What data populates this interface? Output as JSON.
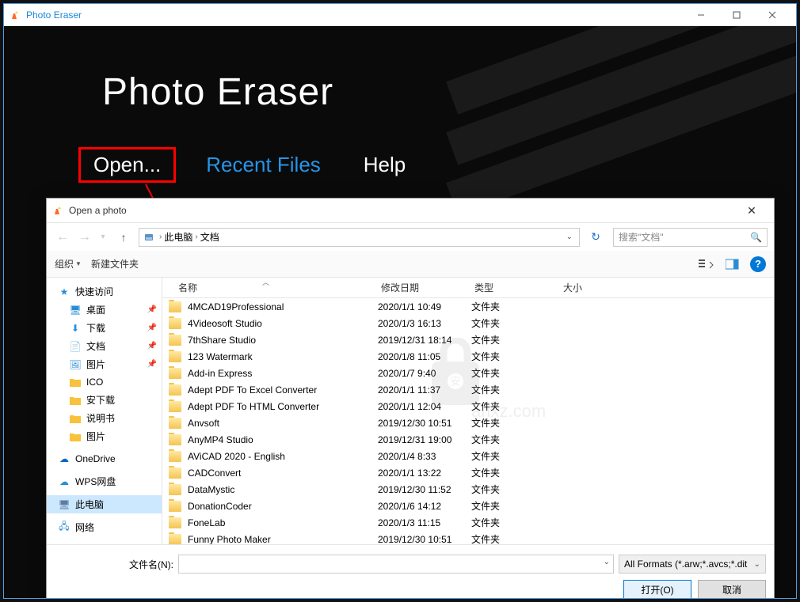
{
  "app": {
    "title": "Photo Eraser",
    "main_title": "Photo Eraser",
    "menu": {
      "open": "Open...",
      "recent": "Recent Files",
      "help": "Help"
    }
  },
  "dialog": {
    "title": "Open a photo",
    "breadcrumb": {
      "root": "此电脑",
      "current": "文档"
    },
    "search_placeholder": "搜索\"文档\"",
    "toolbar": {
      "organize": "组织",
      "new_folder": "新建文件夹"
    },
    "columns": {
      "name": "名称",
      "date": "修改日期",
      "type": "类型",
      "size": "大小"
    },
    "sidebar": {
      "quick_access": "快速访问",
      "items": [
        {
          "label": "桌面",
          "icon": "desktop",
          "pinned": true
        },
        {
          "label": "下载",
          "icon": "download",
          "pinned": true
        },
        {
          "label": "文档",
          "icon": "docs",
          "pinned": true
        },
        {
          "label": "图片",
          "icon": "pics",
          "pinned": true
        },
        {
          "label": "ICO",
          "icon": "folder",
          "pinned": false
        },
        {
          "label": "安下载",
          "icon": "folder",
          "pinned": false
        },
        {
          "label": "说明书",
          "icon": "folder",
          "pinned": false
        },
        {
          "label": "图片",
          "icon": "folder",
          "pinned": false
        }
      ],
      "onedrive": "OneDrive",
      "wps": "WPS网盘",
      "this_pc": "此电脑",
      "network": "网络"
    },
    "files": [
      {
        "name": "4MCAD19Professional",
        "date": "2020/1/1 10:49",
        "type": "文件夹"
      },
      {
        "name": "4Videosoft Studio",
        "date": "2020/1/3 16:13",
        "type": "文件夹"
      },
      {
        "name": "7thShare Studio",
        "date": "2019/12/31 18:14",
        "type": "文件夹"
      },
      {
        "name": "123 Watermark",
        "date": "2020/1/8 11:05",
        "type": "文件夹"
      },
      {
        "name": "Add-in Express",
        "date": "2020/1/7 9:40",
        "type": "文件夹"
      },
      {
        "name": "Adept PDF To Excel Converter",
        "date": "2020/1/1 11:37",
        "type": "文件夹"
      },
      {
        "name": "Adept PDF To HTML Converter",
        "date": "2020/1/1 12:04",
        "type": "文件夹"
      },
      {
        "name": "Anvsoft",
        "date": "2019/12/30 10:51",
        "type": "文件夹"
      },
      {
        "name": "AnyMP4 Studio",
        "date": "2019/12/31 19:00",
        "type": "文件夹"
      },
      {
        "name": "AViCAD 2020 - English",
        "date": "2020/1/4 8:33",
        "type": "文件夹"
      },
      {
        "name": "CADConvert",
        "date": "2020/1/1 13:22",
        "type": "文件夹"
      },
      {
        "name": "DataMystic",
        "date": "2019/12/30 11:52",
        "type": "文件夹"
      },
      {
        "name": "DonationCoder",
        "date": "2020/1/6 14:12",
        "type": "文件夹"
      },
      {
        "name": "FoneLab",
        "date": "2020/1/3 11:15",
        "type": "文件夹"
      },
      {
        "name": "Funny Photo Maker",
        "date": "2019/12/30 10:51",
        "type": "文件夹"
      }
    ],
    "footer": {
      "filename_label": "文件名(N):",
      "filter": "All Formats (*.arw;*.avcs;*.dit",
      "open": "打开(O)",
      "cancel": "取消"
    }
  }
}
